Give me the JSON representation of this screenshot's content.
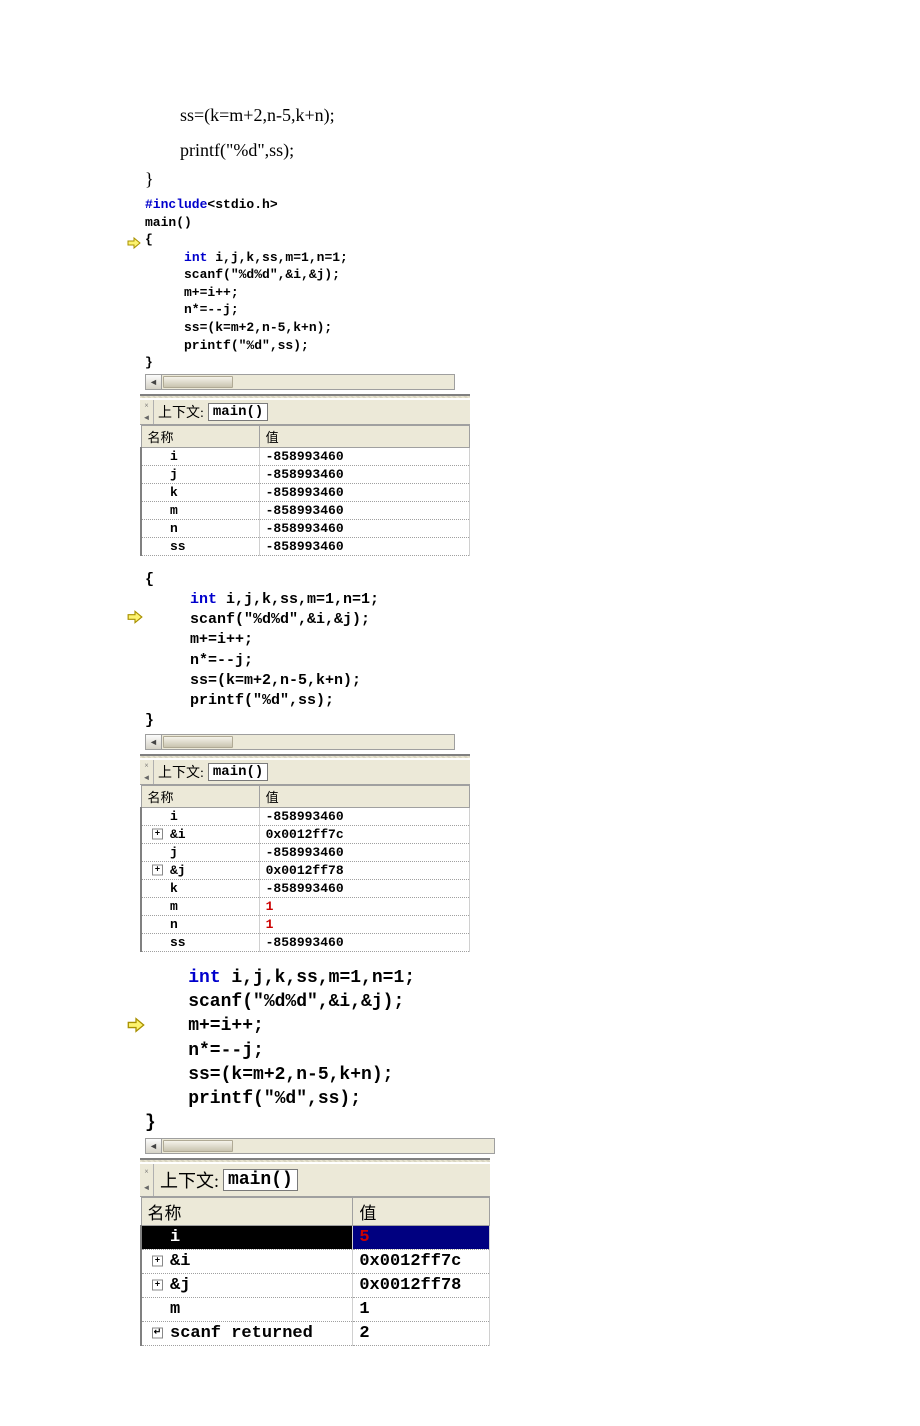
{
  "intro": {
    "line1": "ss=(k=m+2,n-5,k+n);",
    "line2": "printf(\"%d\",ss);",
    "brace": "}"
  },
  "step1": {
    "code": [
      {
        "t": "kw",
        "s": "#include"
      },
      {
        "t": "n",
        "s": "<stdio.h>\n"
      },
      {
        "t": "n",
        "s": "main()\n"
      },
      {
        "t": "n",
        "s": "{\n"
      },
      {
        "t": "n",
        "s": "     "
      },
      {
        "t": "kw",
        "s": "int"
      },
      {
        "t": "n",
        "s": " i,j,k,ss,m=1,n=1;\n"
      },
      {
        "t": "n",
        "s": "     scanf(\"%d%d\",&i,&j);\n"
      },
      {
        "t": "n",
        "s": "     m+=i++;\n"
      },
      {
        "t": "n",
        "s": "     n*=--j;\n"
      },
      {
        "t": "n",
        "s": "     ss=(k=m+2,n-5,k+n);\n"
      },
      {
        "t": "n",
        "s": "     printf(\"%d\",ss);\n"
      },
      {
        "t": "n",
        "s": "}"
      }
    ],
    "arrow_line": 3,
    "context_label": "上下文:",
    "context_value": "main()",
    "headers": [
      "名称",
      "值"
    ],
    "rows": [
      {
        "name": "i",
        "value": "-858993460"
      },
      {
        "name": "j",
        "value": "-858993460"
      },
      {
        "name": "k",
        "value": "-858993460"
      },
      {
        "name": "m",
        "value": "-858993460"
      },
      {
        "name": "n",
        "value": "-858993460"
      },
      {
        "name": "ss",
        "value": "-858993460"
      }
    ]
  },
  "step2": {
    "code": [
      {
        "t": "n",
        "s": "{\n"
      },
      {
        "t": "n",
        "s": "     "
      },
      {
        "t": "kw",
        "s": "int"
      },
      {
        "t": "n",
        "s": " i,j,k,ss,m=1,n=1;\n"
      },
      {
        "t": "n",
        "s": "     scanf(\"%d%d\",&i,&j);\n"
      },
      {
        "t": "n",
        "s": "     m+=i++;\n"
      },
      {
        "t": "n",
        "s": "     n*=--j;\n"
      },
      {
        "t": "n",
        "s": "     ss=(k=m+2,n-5,k+n);\n"
      },
      {
        "t": "n",
        "s": "     printf(\"%d\",ss);\n"
      },
      {
        "t": "n",
        "s": "}"
      }
    ],
    "arrow_line": 2,
    "context_label": "上下文:",
    "context_value": "main()",
    "headers": [
      "名称",
      "值"
    ],
    "rows": [
      {
        "name": "i",
        "value": "-858993460"
      },
      {
        "name": "&i",
        "value": "0x0012ff7c",
        "expand": true
      },
      {
        "name": "j",
        "value": "-858993460"
      },
      {
        "name": "&j",
        "value": "0x0012ff78",
        "expand": true
      },
      {
        "name": "k",
        "value": "-858993460"
      },
      {
        "name": "m",
        "value": "1",
        "red": true
      },
      {
        "name": "n",
        "value": "1",
        "red": true
      },
      {
        "name": "ss",
        "value": "-858993460"
      }
    ]
  },
  "step3": {
    "code": [
      {
        "t": "n",
        "s": "    "
      },
      {
        "t": "kw",
        "s": "int"
      },
      {
        "t": "n",
        "s": " i,j,k,ss,m=1,n=1;\n"
      },
      {
        "t": "n",
        "s": "    scanf(\"%d%d\",&i,&j);\n"
      },
      {
        "t": "n",
        "s": "    m+=i++;\n"
      },
      {
        "t": "n",
        "s": "    n*=--j;\n"
      },
      {
        "t": "n",
        "s": "    ss=(k=m+2,n-5,k+n);\n"
      },
      {
        "t": "n",
        "s": "    printf(\"%d\",ss);\n"
      },
      {
        "t": "n",
        "s": "}"
      }
    ],
    "arrow_line": 2,
    "context_label": "上下文:",
    "context_value": "main()",
    "headers": [
      "名称",
      "值"
    ],
    "rows": [
      {
        "name": "i",
        "value": "5",
        "selected": true,
        "red": true
      },
      {
        "name": "&i",
        "value": "0x0012ff7c",
        "expand": true
      },
      {
        "name": "&j",
        "value": "0x0012ff78",
        "expand": true
      },
      {
        "name": "m",
        "value": "1"
      },
      {
        "name": "scanf returned",
        "value": "2",
        "expand": true,
        "ret": true
      }
    ]
  }
}
